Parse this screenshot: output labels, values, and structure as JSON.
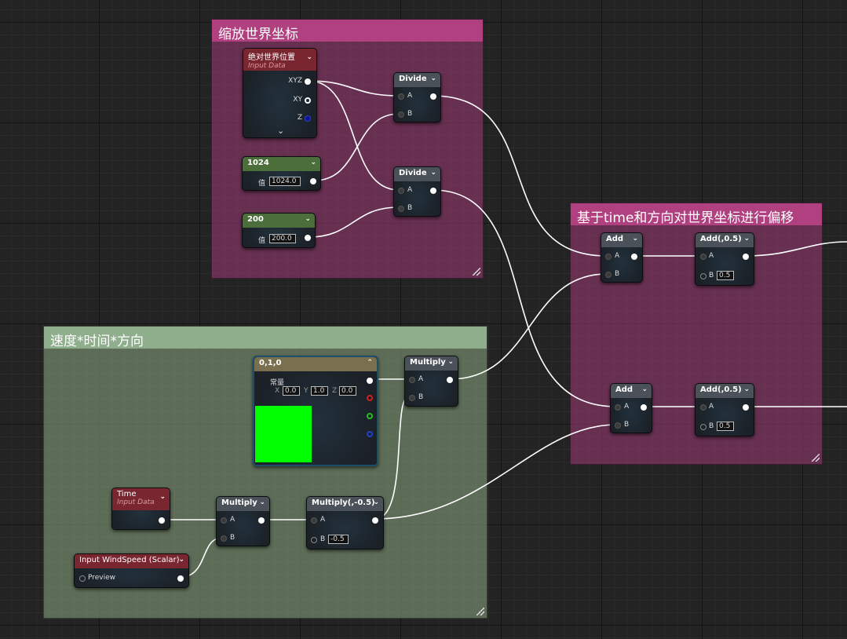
{
  "comments": {
    "scale": "缩放世界坐标",
    "offset": "基于time和方向对世界坐标进行偏移",
    "speed": "速度*时间*方向"
  },
  "nodes": {
    "abs_world": {
      "title": "绝对世界位置",
      "subtitle": "Input Data",
      "pin_xyz": "XYZ",
      "pin_xy": "XY",
      "pin_z": "Z",
      "expand": "⌄"
    },
    "const_1024": {
      "title": "1024",
      "label": "值",
      "value": "1024.0"
    },
    "const_200": {
      "title": "200",
      "label": "值",
      "value": "200.0"
    },
    "divide1": {
      "title": "Divide",
      "a": "A",
      "b": "B"
    },
    "divide2": {
      "title": "Divide",
      "a": "A",
      "b": "B"
    },
    "add1": {
      "title": "Add",
      "a": "A",
      "b": "B"
    },
    "add2": {
      "title": "Add",
      "a": "A",
      "b": "B"
    },
    "add05_1": {
      "title": "Add(,0.5)",
      "a": "A",
      "b": "B",
      "b_value": "0.5"
    },
    "add05_2": {
      "title": "Add(,0.5)",
      "a": "A",
      "b": "B",
      "b_value": "0.5"
    },
    "vec010": {
      "title": "0,1,0",
      "label": "常量",
      "x_label": "X",
      "x": "0.0",
      "y_label": "Y",
      "y": "1.0",
      "z_label": "Z",
      "z": "0.0",
      "swatch_color": "#00ff00"
    },
    "multiply_top": {
      "title": "Multiply",
      "a": "A",
      "b": "B"
    },
    "time": {
      "title": "Time",
      "subtitle": "Input Data"
    },
    "multiply_mid": {
      "title": "Multiply",
      "a": "A",
      "b": "B"
    },
    "multiply_neg": {
      "title": "Multiply(,-0.5)",
      "a": "A",
      "b": "B",
      "b_value": "-0.5"
    },
    "wind_speed": {
      "title": "Input WindSpeed (Scalar)",
      "pin": "Preview"
    }
  },
  "colors": {
    "comment_pink": "#b0407f",
    "comment_green": "#8fae8c",
    "header_grey": "#4a5158",
    "header_green": "#4b6e3a",
    "header_red": "#7a2631",
    "wire": "#ffffff"
  }
}
